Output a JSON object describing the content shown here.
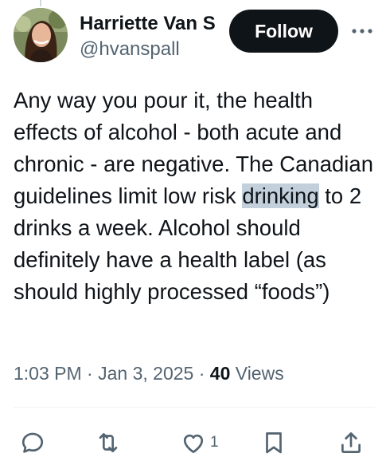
{
  "author": {
    "display_name": "Harriette Van Spall",
    "handle": "@hvanspall"
  },
  "follow_label": "Follow",
  "tweet": {
    "text_before": "Any way you pour it, the health effects of alcohol - both acute and chronic - are negative. The Canadian guidelines limit low risk ",
    "highlighted": "drinking",
    "text_after": " to 2 drinks a week. Alcohol should definitely have a health label (as should highly processed “foods”)"
  },
  "meta": {
    "time": "1:03 PM",
    "separator_1": " · ",
    "date": "Jan 3, 2025",
    "separator_2": " · ",
    "views_count": "40",
    "views_label": " Views"
  },
  "actions": {
    "like_count": "1"
  },
  "icons": {
    "reply": "reply-icon",
    "retweet": "retweet-icon",
    "like": "heart-icon",
    "bookmark": "bookmark-icon",
    "share": "share-icon",
    "more": "more-icon"
  },
  "colors": {
    "text": "#0f1419",
    "secondary": "#536471",
    "highlight": "#c3d0db",
    "button": "#0f1419"
  }
}
